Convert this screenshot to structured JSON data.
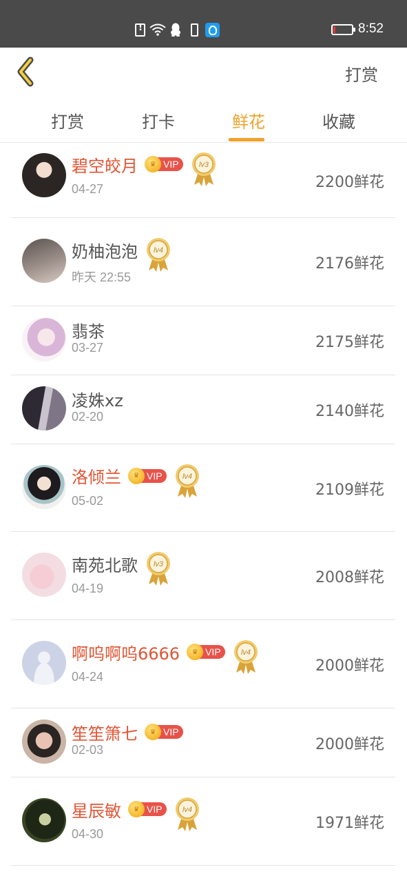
{
  "status_bar": {
    "time": "8:52",
    "icons": [
      "sim-alert-icon",
      "wifi-icon",
      "qq-icon",
      "phone-icon",
      "app-notification-icon"
    ],
    "battery_level": 0.1,
    "battery_color": "#e53935"
  },
  "header": {
    "back_icon": "chevron-left-icon",
    "action_label": "打赏"
  },
  "tabs": [
    {
      "label": "打赏",
      "active": false
    },
    {
      "label": "打卡",
      "active": false
    },
    {
      "label": "鲜花",
      "active": true
    },
    {
      "label": "收藏",
      "active": false
    }
  ],
  "colors": {
    "accent": "#f0a22a",
    "vip_name": "#e05535",
    "vip_badge": "#e8524a",
    "medal": "#d9a33a"
  },
  "vip_label": "VIP",
  "rows": [
    {
      "name": "碧空皎月",
      "vip": true,
      "level": "lv3",
      "date": "04-27",
      "amount": "2200鲜花",
      "avatar": "avatar-female-portrait"
    },
    {
      "name": "奶柚泡泡",
      "vip": false,
      "level": "lv4",
      "date": "昨天 22:55",
      "amount": "2176鲜花",
      "avatar": "avatar-blurred-photo"
    },
    {
      "name": "翡茶",
      "vip": false,
      "level": "",
      "date": "03-27",
      "amount": "2175鲜花",
      "avatar": "avatar-anime-girl"
    },
    {
      "name": "凌姝xz",
      "vip": false,
      "level": "",
      "date": "02-20",
      "amount": "2140鲜花",
      "avatar": "avatar-dark-hair"
    },
    {
      "name": "洛倾兰",
      "vip": true,
      "level": "lv4",
      "date": "05-02",
      "amount": "2109鲜花",
      "avatar": "avatar-illustrated-figure"
    },
    {
      "name": "南苑北歌",
      "vip": false,
      "level": "lv3",
      "date": "04-19",
      "amount": "2008鲜花",
      "avatar": "avatar-pink-hands"
    },
    {
      "name": "啊呜啊呜6666",
      "vip": true,
      "level": "lv4",
      "date": "04-24",
      "amount": "2000鲜花",
      "avatar": "avatar-default-placeholder"
    },
    {
      "name": "笙笙箫七",
      "vip": true,
      "level": "",
      "date": "02-03",
      "amount": "2000鲜花",
      "avatar": "avatar-portrait-photo"
    },
    {
      "name": "星辰敏",
      "vip": true,
      "level": "lv4",
      "date": "04-30",
      "amount": "1971鲜花",
      "avatar": "avatar-dark-portrait"
    }
  ]
}
